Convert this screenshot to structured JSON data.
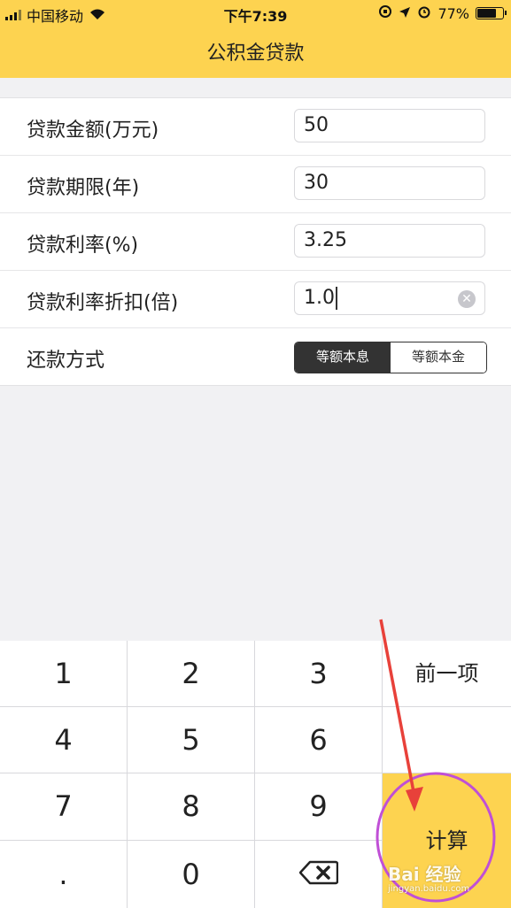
{
  "status_bar": {
    "carrier": "中国移动",
    "time": "下午7:39",
    "battery_percent": "77%",
    "battery_level": 0.77
  },
  "header": {
    "title": "公积金贷款",
    "bg_color": "#fdd350"
  },
  "form": {
    "rows": [
      {
        "label": "贷款金额(万元)",
        "value": "50"
      },
      {
        "label": "贷款期限(年)",
        "value": "30"
      },
      {
        "label": "贷款利率(%)",
        "value": "3.25"
      },
      {
        "label": "贷款利率折扣(倍)",
        "value": "1.0"
      },
      {
        "label": "还款方式"
      }
    ],
    "repayment_options": [
      "等额本息",
      "等额本金"
    ],
    "repayment_selected": "等额本息"
  },
  "keypad": {
    "keys": [
      "1",
      "2",
      "3",
      "4",
      "5",
      "6",
      "7",
      "8",
      "9",
      ".",
      "0"
    ],
    "prev_label": "前一项",
    "calc_label": "计算"
  },
  "watermark": {
    "brand": "Bai 经验",
    "url": "jingyan.baidu.com"
  }
}
